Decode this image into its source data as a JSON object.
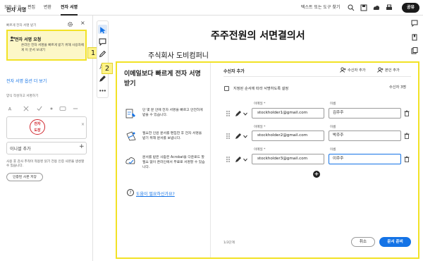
{
  "topbar": {
    "tabs": [
      "모든 도구",
      "편집",
      "변환",
      "전자 서명"
    ],
    "active_tab": "전자 서명",
    "search_placeholder": "텍스트 또는 도구 찾기",
    "share_label": "공유"
  },
  "left_panel": {
    "title": "전자 서명",
    "quick_label": "빠르게 전자 서명 받기",
    "request_title": "전자 서명 요청",
    "request_desc": "온라인 전자 서명을 빠르게 받기 위해 사용자에게 이 문서 보내기",
    "more_options": "전자 서명 옵션 더 보기",
    "insert_label": "양식 작성하고 서명하기",
    "stamp_text": "전자\n도장",
    "initial_label": "이니셜 추가",
    "footnote": "사용 후 감사 추적이 적용된 읽기 전용 인증 사본을 생성할 수 있습니다.",
    "cert_button": "인증된 사본 저장"
  },
  "document": {
    "title": "주주전원의 서면결의서",
    "company": "주식회사 도비컴퍼니"
  },
  "dialog": {
    "headline": "이메일보다 빠르게 전자 서명 받기",
    "features": [
      "단 몇 분 안에 전자 서명을 빠르고 안전하게 받을 수 있습니다.",
      "필요한 인원 문서를 편집한 후 전자 서명을 받기 위해 문서를 보냅니다.",
      "문서를 받은 사람은 Acrobat을 다운로드 할 필요 없이 온라인에서 무료로 서명할 수 있습니다."
    ],
    "help_link": "도움이 필요하신가요?",
    "recipients_title": "수신자 추가",
    "add_recipient": "수신자 추가",
    "add_self": "본인 추가",
    "order_label": "지정된 순서에 따라 서명하도록 설정",
    "recipient_count": "수신자 3명",
    "email_label": "이메일 *",
    "name_label": "이름",
    "recipients": [
      {
        "email": "stockholder1@gmail.com",
        "name": "김주주"
      },
      {
        "email": "stockholder2@gmail.com",
        "name": "박주주"
      },
      {
        "email": "stockholder3@gmail.com",
        "name": "이주주"
      }
    ],
    "pager": "1/3단계",
    "cancel_label": "취소",
    "prepare_label": "문서 준비"
  },
  "callouts": [
    "1",
    "2"
  ],
  "colors": {
    "accent": "#1473e6",
    "highlight": "#f2e226",
    "stamp": "#d0282f"
  }
}
